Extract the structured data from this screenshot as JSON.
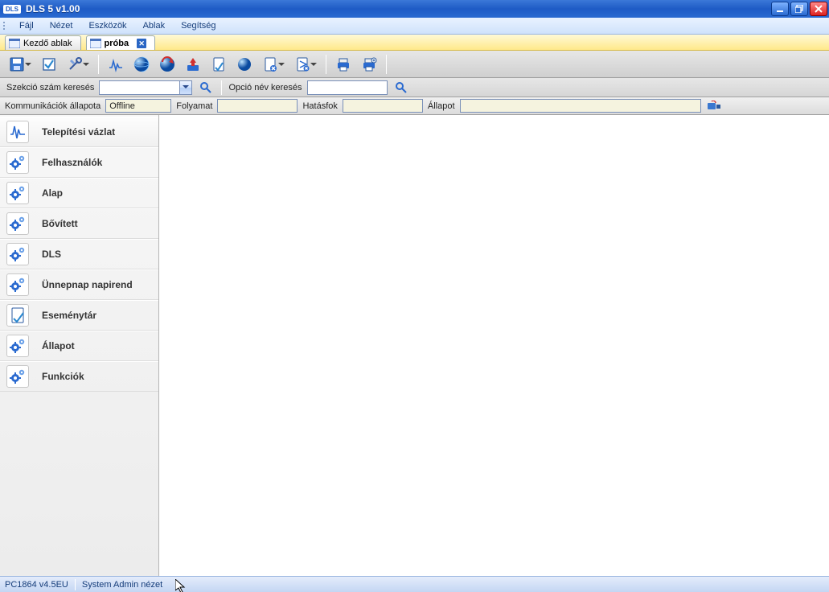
{
  "window": {
    "title": "DLS 5 v1.00",
    "badge": "DLS"
  },
  "menubar": [
    "Fájl",
    "Nézet",
    "Eszközök",
    "Ablak",
    "Segítség"
  ],
  "tabs": [
    {
      "label": "Kezdő ablak",
      "active": false,
      "closable": false
    },
    {
      "label": "próba",
      "active": true,
      "closable": true
    }
  ],
  "toolbar": [
    "save",
    "checkbox",
    "tools",
    "SEP",
    "signal",
    "globe",
    "globe-sync",
    "upload",
    "page-check",
    "world-small",
    "page-del",
    "page-config",
    "SEP",
    "print",
    "print-setup",
    "SEP"
  ],
  "search": {
    "section_label": "Szekció szám keresés",
    "section_value": "",
    "option_label": "Opció név keresés",
    "option_value": ""
  },
  "commstatus": {
    "label": "Kommunikációk állapota",
    "value": "Offline",
    "process_label": "Folyamat",
    "process_value": "",
    "efficacy_label": "Hatásfok",
    "efficacy_value": "",
    "state_label": "Állapot",
    "state_value": ""
  },
  "sidebar": [
    {
      "label": "Telepítési vázlat",
      "icon": "waveform",
      "active": true
    },
    {
      "label": "Felhasználók",
      "icon": "gear"
    },
    {
      "label": "Alap",
      "icon": "gear"
    },
    {
      "label": "Bővített",
      "icon": "gear"
    },
    {
      "label": "DLS",
      "icon": "gear"
    },
    {
      "label": "Ünnepnap napirend",
      "icon": "gear"
    },
    {
      "label": "Eseménytár",
      "icon": "page-check"
    },
    {
      "label": "Állapot",
      "icon": "gear"
    },
    {
      "label": "Funkciók",
      "icon": "gear"
    }
  ],
  "statusbar": {
    "left": "PC1864 v4.5EU",
    "right": "System Admin nézet"
  }
}
